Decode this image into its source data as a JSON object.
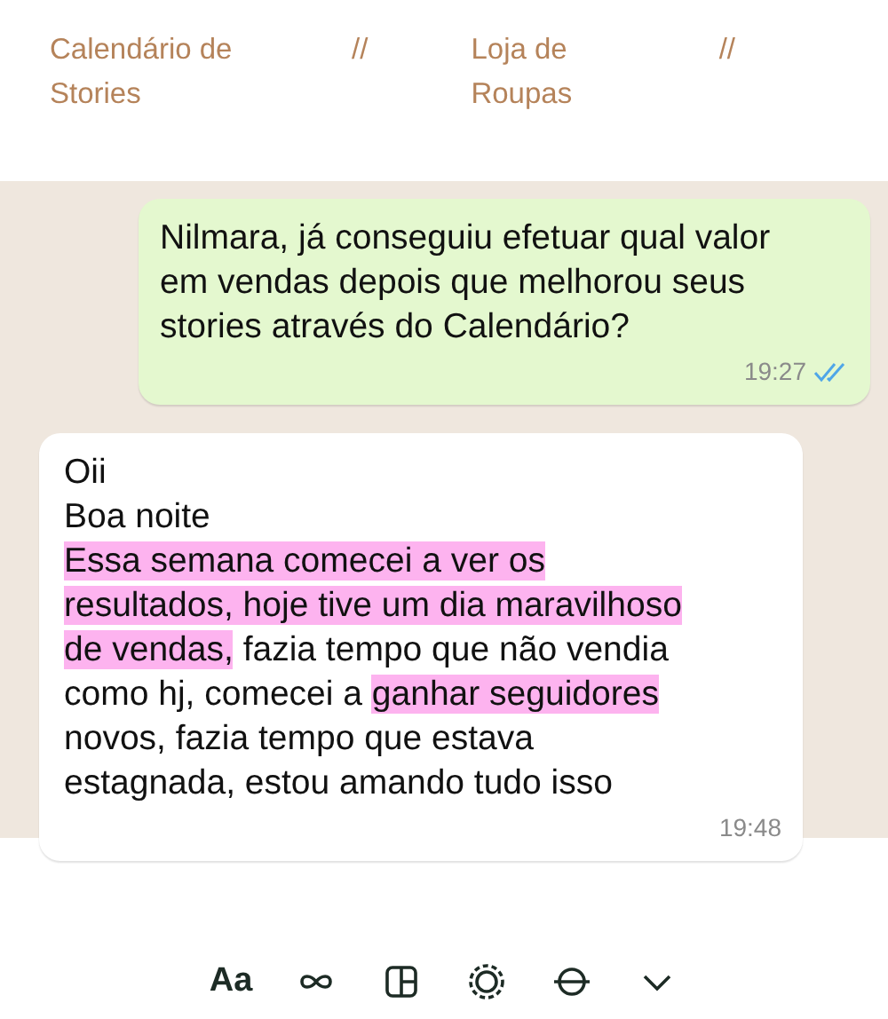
{
  "breadcrumb": [
    {
      "label": "Calendário de Stories",
      "separator": "//"
    },
    {
      "label": "Loja de Roupas",
      "separator": "//"
    }
  ],
  "messages": [
    {
      "kind": "sent",
      "lines": [
        [
          {
            "text": "Nilmara, já conseguiu efetuar qual valor",
            "highlighted": false
          }
        ],
        [
          {
            "text": "em vendas depois que melhorou seus",
            "highlighted": false
          }
        ],
        [
          {
            "text": "stories através do Calendário?",
            "highlighted": false
          }
        ]
      ],
      "time": "19:27",
      "read": true
    },
    {
      "kind": "received",
      "lines": [
        [
          {
            "text": "Oii",
            "highlighted": false
          }
        ],
        [
          {
            "text": "Boa noite",
            "highlighted": false
          }
        ],
        [
          {
            "text": "Essa semana comecei a ver os",
            "highlighted": true
          }
        ],
        [
          {
            "text": "resultados, hoje tive um dia maravilhoso",
            "highlighted": true
          }
        ],
        [
          {
            "text": "de vendas,",
            "highlighted": true
          },
          {
            "text": " fazia tempo que não vendia",
            "highlighted": false
          }
        ],
        [
          {
            "text": "como hj, comecei a ",
            "highlighted": false
          },
          {
            "text": "ganhar seguidores",
            "highlighted": true
          }
        ],
        [
          {
            "text": "novos, fazia tempo que estava",
            "highlighted": false
          }
        ],
        [
          {
            "text": "estagnada, estou amando tudo isso",
            "highlighted": false
          }
        ]
      ],
      "time": "19:48",
      "read": false
    }
  ],
  "toolbar": {
    "text_button": "Aa"
  }
}
